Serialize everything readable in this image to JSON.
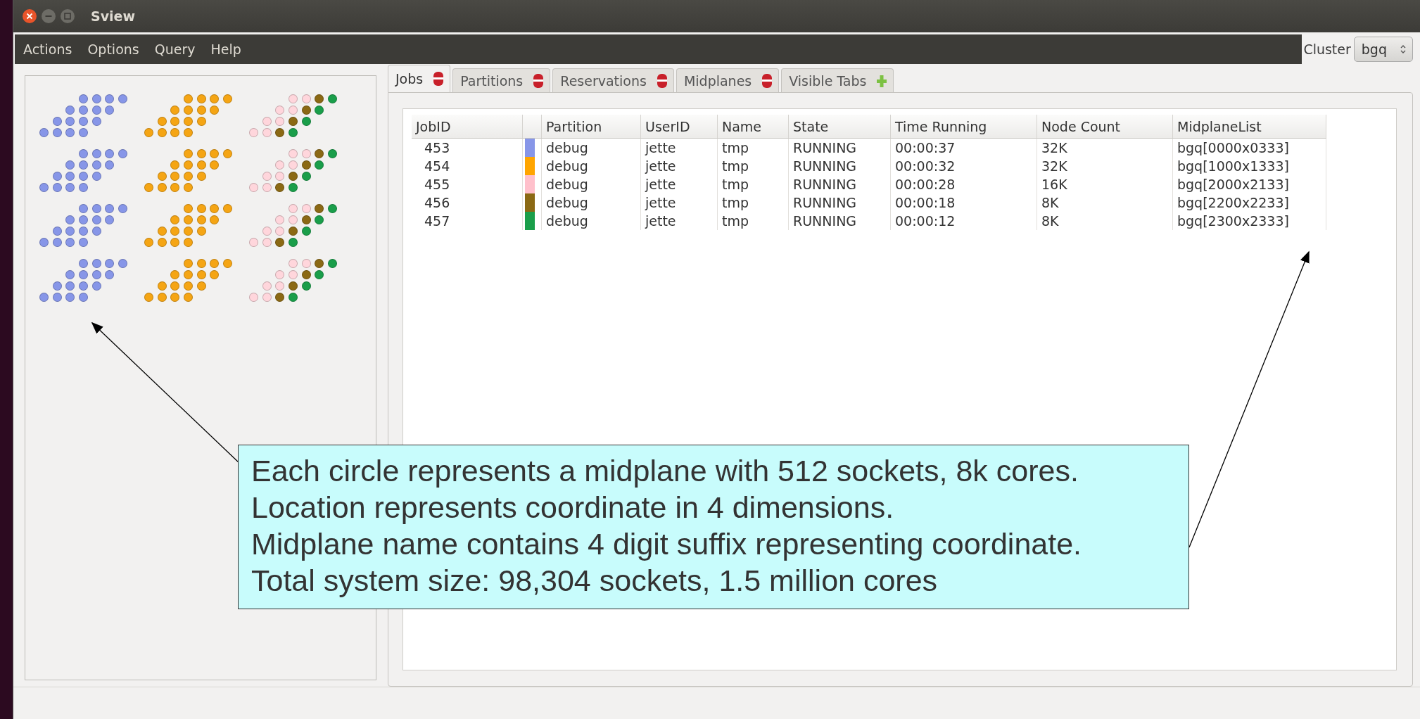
{
  "window": {
    "title": "Sview"
  },
  "menu": [
    "Actions",
    "Options",
    "Query",
    "Help"
  ],
  "cluster": {
    "label": "Cluster",
    "value": "bgq"
  },
  "midplane_map": {
    "blocks": [
      {
        "circles": [
          {
            "color": "#8796e8"
          },
          {
            "color": "#8796e8"
          },
          {
            "color": "#8796e8"
          },
          {
            "color": "#8796e8"
          }
        ]
      },
      {
        "circles": [
          {
            "color": "#f5a514"
          },
          {
            "color": "#f5a514"
          },
          {
            "color": "#f5a514"
          },
          {
            "color": "#f5a514"
          }
        ]
      },
      {
        "circles": [
          {
            "color": "#ffd6dc"
          },
          {
            "color": "#ffd6dc"
          },
          {
            "color": "#8b6914"
          },
          {
            "color": "#1a9e4a"
          }
        ]
      },
      {
        "circles": [
          {
            "color": "#8796e8"
          },
          {
            "color": "#8796e8"
          },
          {
            "color": "#8796e8"
          },
          {
            "color": "#8796e8"
          }
        ]
      },
      {
        "circles": [
          {
            "color": "#f5a514"
          },
          {
            "color": "#f5a514"
          },
          {
            "color": "#f5a514"
          },
          {
            "color": "#f5a514"
          }
        ]
      },
      {
        "circles": [
          {
            "color": "#ffd6dc"
          },
          {
            "color": "#ffd6dc"
          },
          {
            "color": "#8b6914"
          },
          {
            "color": "#1a9e4a"
          }
        ]
      },
      {
        "circles": [
          {
            "color": "#8796e8"
          },
          {
            "color": "#8796e8"
          },
          {
            "color": "#8796e8"
          },
          {
            "color": "#8796e8"
          }
        ]
      },
      {
        "circles": [
          {
            "color": "#f5a514"
          },
          {
            "color": "#f5a514"
          },
          {
            "color": "#f5a514"
          },
          {
            "color": "#f5a514"
          }
        ]
      },
      {
        "circles": [
          {
            "color": "#ffd6dc"
          },
          {
            "color": "#ffd6dc"
          },
          {
            "color": "#8b6914"
          },
          {
            "color": "#1a9e4a"
          }
        ]
      },
      {
        "circles": [
          {
            "color": "#8796e8"
          },
          {
            "color": "#8796e8"
          },
          {
            "color": "#8796e8"
          },
          {
            "color": "#8796e8"
          }
        ]
      },
      {
        "circles": [
          {
            "color": "#f5a514"
          },
          {
            "color": "#f5a514"
          },
          {
            "color": "#f5a514"
          },
          {
            "color": "#f5a514"
          }
        ]
      },
      {
        "circles": [
          {
            "color": "#ffd6dc"
          },
          {
            "color": "#ffd6dc"
          },
          {
            "color": "#8b6914"
          },
          {
            "color": "#1a9e4a"
          }
        ]
      }
    ]
  },
  "tabs": [
    {
      "label": "Jobs",
      "selected": true,
      "kind": "remove"
    },
    {
      "label": "Partitions",
      "selected": false,
      "kind": "remove"
    },
    {
      "label": "Reservations",
      "selected": false,
      "kind": "remove"
    },
    {
      "label": "Midplanes",
      "selected": false,
      "kind": "remove"
    },
    {
      "label": "Visible Tabs",
      "selected": false,
      "kind": "add"
    }
  ],
  "table": {
    "columns": [
      "JobID",
      "",
      "Partition",
      "UserID",
      "Name",
      "State",
      "Time Running",
      "Node Count",
      "MidplaneList"
    ],
    "rows": [
      {
        "job_id": "453",
        "color": "#8796e8",
        "partition": "debug",
        "user": "jette",
        "name": "tmp",
        "state": "RUNNING",
        "time": "00:00:37",
        "nodes": "32K",
        "midplanes": "bgq[0000x0333]"
      },
      {
        "job_id": "454",
        "color": "#ffa500",
        "partition": "debug",
        "user": "jette",
        "name": "tmp",
        "state": "RUNNING",
        "time": "00:00:32",
        "nodes": "32K",
        "midplanes": "bgq[1000x1333]"
      },
      {
        "job_id": "455",
        "color": "#ffc0cb",
        "partition": "debug",
        "user": "jette",
        "name": "tmp",
        "state": "RUNNING",
        "time": "00:00:28",
        "nodes": "16K",
        "midplanes": "bgq[2000x2133]"
      },
      {
        "job_id": "456",
        "color": "#8b6914",
        "partition": "debug",
        "user": "jette",
        "name": "tmp",
        "state": "RUNNING",
        "time": "00:00:18",
        "nodes": "8K",
        "midplanes": "bgq[2200x2233]"
      },
      {
        "job_id": "457",
        "color": "#1a9e4a",
        "partition": "debug",
        "user": "jette",
        "name": "tmp",
        "state": "RUNNING",
        "time": "00:00:12",
        "nodes": "8K",
        "midplanes": "bgq[2300x2333]"
      }
    ]
  },
  "callout": {
    "lines": [
      "Each circle represents a midplane with 512 sockets, 8k cores.",
      "Location represents coordinate in 4 dimensions.",
      "Midplane name contains 4 digit suffix representing coordinate.",
      "Total system size: 98,304 sockets, 1.5 million cores"
    ]
  }
}
